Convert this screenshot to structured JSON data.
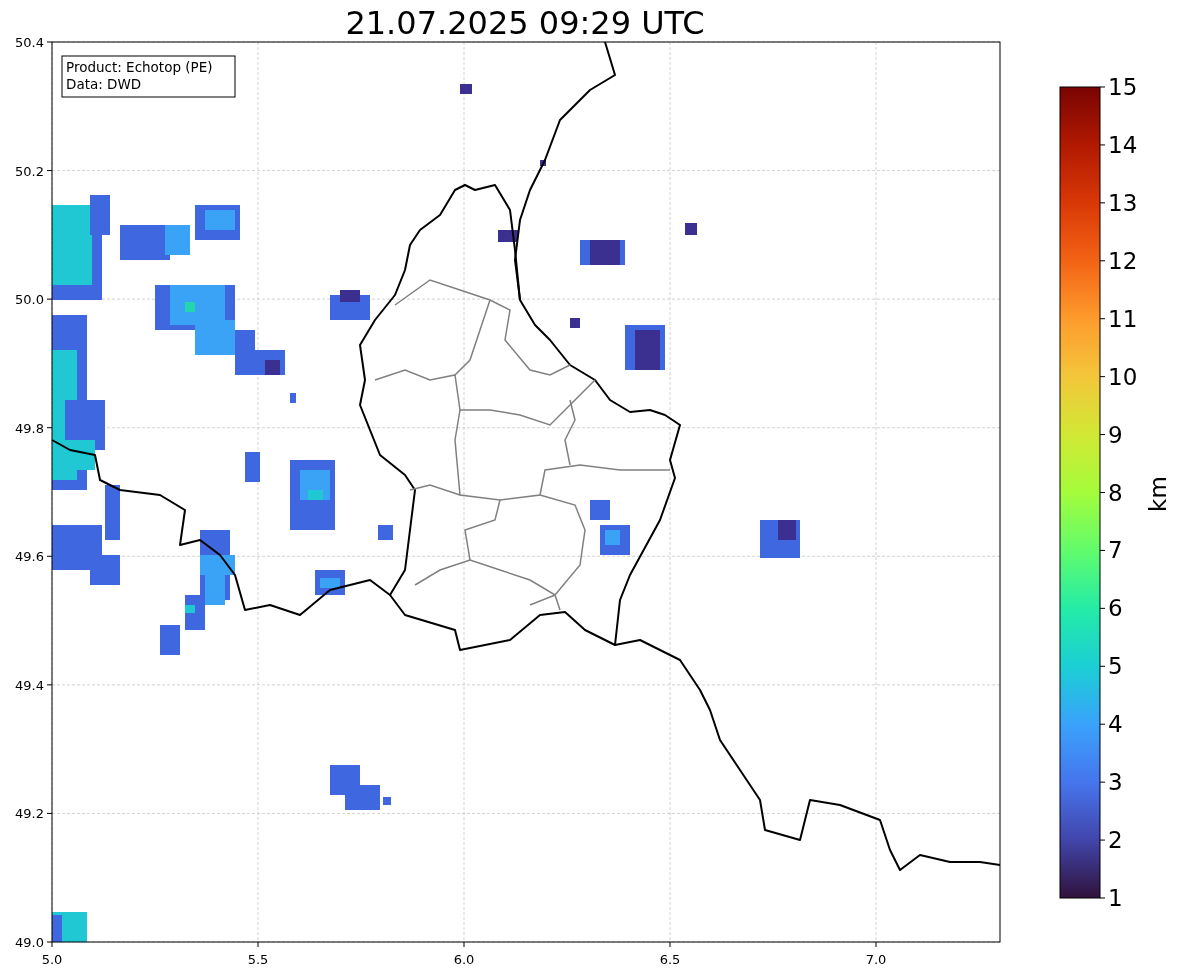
{
  "title": "21.07.2025 09:29 UTC",
  "info_box": [
    "Product: Echotop (PE)",
    "Data: DWD"
  ],
  "x_ticks": [
    "5.0",
    "5.5",
    "6.0",
    "6.5",
    "7.0"
  ],
  "y_ticks": [
    "50.4",
    "50.2",
    "50.0",
    "49.8",
    "49.6",
    "49.4",
    "49.2",
    "49.0"
  ],
  "colorbar": {
    "label": "km",
    "ticks": [
      "15",
      "14",
      "13",
      "12",
      "11",
      "10",
      "9",
      "8",
      "7",
      "6",
      "5",
      "4",
      "3",
      "2",
      "1"
    ]
  }
}
